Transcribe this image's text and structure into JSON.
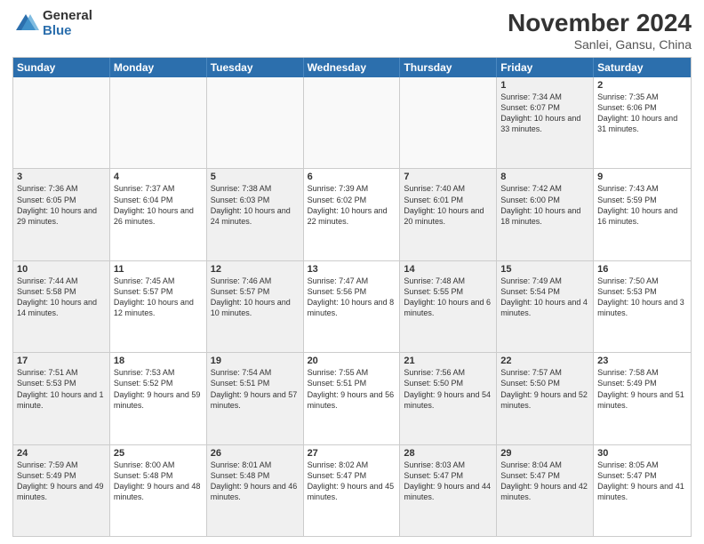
{
  "logo": {
    "general": "General",
    "blue": "Blue"
  },
  "title": "November 2024",
  "subtitle": "Sanlei, Gansu, China",
  "headers": [
    "Sunday",
    "Monday",
    "Tuesday",
    "Wednesday",
    "Thursday",
    "Friday",
    "Saturday"
  ],
  "weeks": [
    [
      {
        "day": "",
        "text": "",
        "empty": true
      },
      {
        "day": "",
        "text": "",
        "empty": true
      },
      {
        "day": "",
        "text": "",
        "empty": true
      },
      {
        "day": "",
        "text": "",
        "empty": true
      },
      {
        "day": "",
        "text": "",
        "empty": true
      },
      {
        "day": "1",
        "text": "Sunrise: 7:34 AM\nSunset: 6:07 PM\nDaylight: 10 hours and 33 minutes.",
        "shaded": true
      },
      {
        "day": "2",
        "text": "Sunrise: 7:35 AM\nSunset: 6:06 PM\nDaylight: 10 hours and 31 minutes.",
        "shaded": false
      }
    ],
    [
      {
        "day": "3",
        "text": "Sunrise: 7:36 AM\nSunset: 6:05 PM\nDaylight: 10 hours and 29 minutes.",
        "shaded": true
      },
      {
        "day": "4",
        "text": "Sunrise: 7:37 AM\nSunset: 6:04 PM\nDaylight: 10 hours and 26 minutes.",
        "shaded": false
      },
      {
        "day": "5",
        "text": "Sunrise: 7:38 AM\nSunset: 6:03 PM\nDaylight: 10 hours and 24 minutes.",
        "shaded": true
      },
      {
        "day": "6",
        "text": "Sunrise: 7:39 AM\nSunset: 6:02 PM\nDaylight: 10 hours and 22 minutes.",
        "shaded": false
      },
      {
        "day": "7",
        "text": "Sunrise: 7:40 AM\nSunset: 6:01 PM\nDaylight: 10 hours and 20 minutes.",
        "shaded": true
      },
      {
        "day": "8",
        "text": "Sunrise: 7:42 AM\nSunset: 6:00 PM\nDaylight: 10 hours and 18 minutes.",
        "shaded": true
      },
      {
        "day": "9",
        "text": "Sunrise: 7:43 AM\nSunset: 5:59 PM\nDaylight: 10 hours and 16 minutes.",
        "shaded": false
      }
    ],
    [
      {
        "day": "10",
        "text": "Sunrise: 7:44 AM\nSunset: 5:58 PM\nDaylight: 10 hours and 14 minutes.",
        "shaded": true
      },
      {
        "day": "11",
        "text": "Sunrise: 7:45 AM\nSunset: 5:57 PM\nDaylight: 10 hours and 12 minutes.",
        "shaded": false
      },
      {
        "day": "12",
        "text": "Sunrise: 7:46 AM\nSunset: 5:57 PM\nDaylight: 10 hours and 10 minutes.",
        "shaded": true
      },
      {
        "day": "13",
        "text": "Sunrise: 7:47 AM\nSunset: 5:56 PM\nDaylight: 10 hours and 8 minutes.",
        "shaded": false
      },
      {
        "day": "14",
        "text": "Sunrise: 7:48 AM\nSunset: 5:55 PM\nDaylight: 10 hours and 6 minutes.",
        "shaded": true
      },
      {
        "day": "15",
        "text": "Sunrise: 7:49 AM\nSunset: 5:54 PM\nDaylight: 10 hours and 4 minutes.",
        "shaded": true
      },
      {
        "day": "16",
        "text": "Sunrise: 7:50 AM\nSunset: 5:53 PM\nDaylight: 10 hours and 3 minutes.",
        "shaded": false
      }
    ],
    [
      {
        "day": "17",
        "text": "Sunrise: 7:51 AM\nSunset: 5:53 PM\nDaylight: 10 hours and 1 minute.",
        "shaded": true
      },
      {
        "day": "18",
        "text": "Sunrise: 7:53 AM\nSunset: 5:52 PM\nDaylight: 9 hours and 59 minutes.",
        "shaded": false
      },
      {
        "day": "19",
        "text": "Sunrise: 7:54 AM\nSunset: 5:51 PM\nDaylight: 9 hours and 57 minutes.",
        "shaded": true
      },
      {
        "day": "20",
        "text": "Sunrise: 7:55 AM\nSunset: 5:51 PM\nDaylight: 9 hours and 56 minutes.",
        "shaded": false
      },
      {
        "day": "21",
        "text": "Sunrise: 7:56 AM\nSunset: 5:50 PM\nDaylight: 9 hours and 54 minutes.",
        "shaded": true
      },
      {
        "day": "22",
        "text": "Sunrise: 7:57 AM\nSunset: 5:50 PM\nDaylight: 9 hours and 52 minutes.",
        "shaded": true
      },
      {
        "day": "23",
        "text": "Sunrise: 7:58 AM\nSunset: 5:49 PM\nDaylight: 9 hours and 51 minutes.",
        "shaded": false
      }
    ],
    [
      {
        "day": "24",
        "text": "Sunrise: 7:59 AM\nSunset: 5:49 PM\nDaylight: 9 hours and 49 minutes.",
        "shaded": true
      },
      {
        "day": "25",
        "text": "Sunrise: 8:00 AM\nSunset: 5:48 PM\nDaylight: 9 hours and 48 minutes.",
        "shaded": false
      },
      {
        "day": "26",
        "text": "Sunrise: 8:01 AM\nSunset: 5:48 PM\nDaylight: 9 hours and 46 minutes.",
        "shaded": true
      },
      {
        "day": "27",
        "text": "Sunrise: 8:02 AM\nSunset: 5:47 PM\nDaylight: 9 hours and 45 minutes.",
        "shaded": false
      },
      {
        "day": "28",
        "text": "Sunrise: 8:03 AM\nSunset: 5:47 PM\nDaylight: 9 hours and 44 minutes.",
        "shaded": true
      },
      {
        "day": "29",
        "text": "Sunrise: 8:04 AM\nSunset: 5:47 PM\nDaylight: 9 hours and 42 minutes.",
        "shaded": true
      },
      {
        "day": "30",
        "text": "Sunrise: 8:05 AM\nSunset: 5:47 PM\nDaylight: 9 hours and 41 minutes.",
        "shaded": false
      }
    ]
  ]
}
